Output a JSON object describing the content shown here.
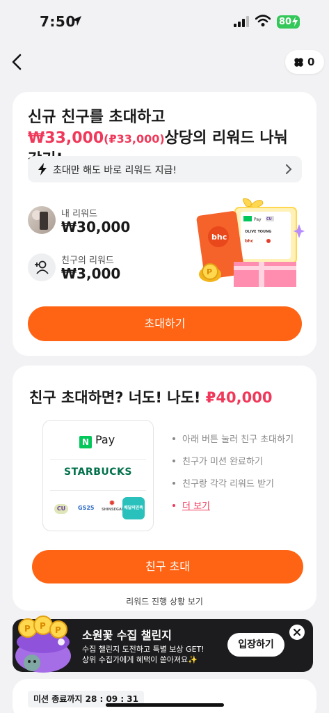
{
  "status_bar": {
    "time": "7:50",
    "battery": "80"
  },
  "header": {
    "clover_count": "0"
  },
  "invite_card": {
    "title_prefix": "신규 친구를 초대하고 ",
    "title_amount": "₩33,000",
    "title_point": "(₽33,000)",
    "title_suffix": "상당의 리워드 나눠 갖기!",
    "banner": "초대만 해도 바로 리워드 지급!",
    "my_reward_label": "내 리워드",
    "my_reward_value": "₩30,000",
    "friend_reward_label": "친구의 리워드",
    "friend_reward_value": "₩3,000",
    "button": "초대하기",
    "gift_brands": [
      "bhc",
      "Pay",
      "CU",
      "OLIVE YOUNG"
    ]
  },
  "benefit_card": {
    "title_prefix": "친구 초대하면? 너도! 나도! ",
    "title_amount": "₽40,000",
    "brands": {
      "npay_n": "N",
      "npay": "Pay",
      "starbucks": "STARBUCKS",
      "cu": "CU",
      "gs25": "GS25",
      "shinsegae": "SHINSEGAE",
      "baemin": "배달의민족"
    },
    "steps": [
      "아래 버튼 눌러 친구 초대하기",
      "친구가 미션 완료하기",
      "친구랑 각각 리워드 받기"
    ],
    "more": "더 보기",
    "button": "친구 초대",
    "progress_link": "리워드 진행 상황 보기"
  },
  "toast": {
    "title": "소원꽃 수집 챌린지",
    "line1": "수집 챌린지 도전하고 특별 보상 GET!",
    "line2": "상위 수집가에게 혜택이 쏟아져요✨",
    "button": "입장하기"
  },
  "mission": {
    "timer": "미션 종료까지 28 : 09 : 31"
  },
  "colors": {
    "accent_orange": "#ff6414",
    "highlight_red": "#f0395a",
    "battery_green": "#34c759"
  }
}
